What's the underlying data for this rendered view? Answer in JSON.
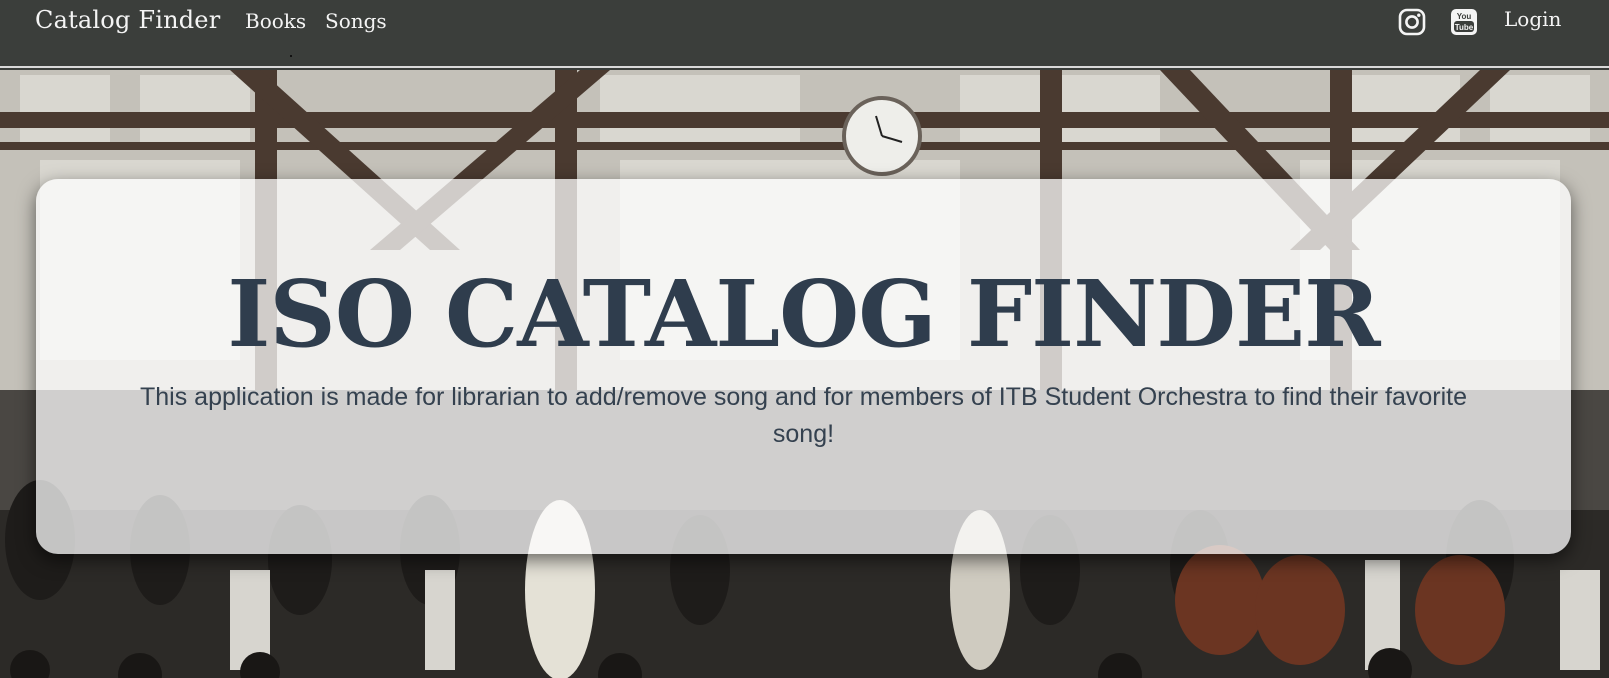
{
  "navbar": {
    "brand": "Catalog Finder",
    "links": [
      {
        "label": "Books"
      },
      {
        "label": "Songs"
      }
    ],
    "login_label": "Login",
    "icons": [
      "instagram-icon",
      "youtube-icon"
    ],
    "youtube_icon_text": [
      "You",
      "Tube"
    ]
  },
  "hero": {
    "title": "ISO CATALOG FINDER",
    "description": "This application is made for librarian to add/remove song and for members of ITB Student Orchestra to find their favorite song!"
  },
  "colors": {
    "navbar_bg": "#3b3e3b",
    "nav_text": "#f4f4f4",
    "title_text": "#2f3d4d",
    "description_text": "#34414f"
  }
}
